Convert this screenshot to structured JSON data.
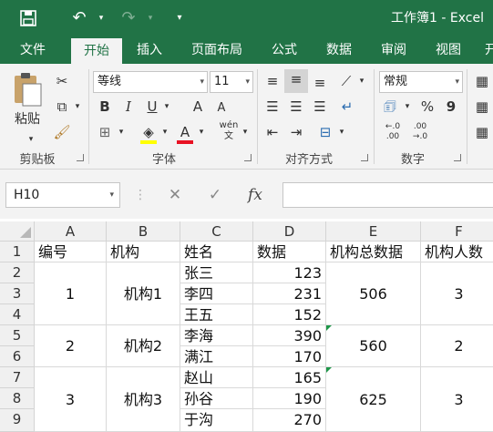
{
  "titlebar": {
    "save_icon": "floppy-disk-icon",
    "undo_icon": "undo-icon",
    "redo_icon": "redo-icon",
    "customize_icon": "chevron-down-icon",
    "title": "工作簿1 - Excel"
  },
  "tabs": [
    "文件",
    "开始",
    "插入",
    "页面布局",
    "公式",
    "数据",
    "审阅",
    "视图",
    "开"
  ],
  "active_tab": "开始",
  "ribbon": {
    "clipboard": {
      "paste_label": "粘贴",
      "group_label": "剪贴板"
    },
    "font": {
      "name": "等线",
      "size": "11",
      "bold": "B",
      "italic": "I",
      "underline": "U",
      "grow": "A",
      "shrink": "A",
      "pinyin": "wén",
      "group_label": "字体"
    },
    "alignment": {
      "group_label": "对齐方式"
    },
    "number": {
      "format": "常规",
      "percent": "%",
      "comma": "9",
      "group_label": "数字"
    }
  },
  "formula_bar": {
    "name_box": "H10",
    "fx_label": "fx",
    "value": ""
  },
  "columns": [
    "A",
    "B",
    "C",
    "D",
    "E",
    "F"
  ],
  "rows": [
    "1",
    "2",
    "3",
    "4",
    "5",
    "6",
    "7",
    "8",
    "9"
  ],
  "headers": {
    "A": "编号",
    "B": "机构",
    "C": "姓名",
    "D": "数据",
    "E": "机构总数据",
    "F": "机构人数"
  },
  "groups": [
    {
      "id": "1",
      "org": "机构1",
      "total": "506",
      "count": "3"
    },
    {
      "id": "2",
      "org": "机构2",
      "total": "560",
      "count": "2"
    },
    {
      "id": "3",
      "org": "机构3",
      "total": "625",
      "count": "3"
    }
  ],
  "names": [
    "张三",
    "李四",
    "王五",
    "李海",
    "满江",
    "赵山",
    "孙谷",
    "于沟"
  ],
  "values": [
    "123",
    "231",
    "152",
    "390",
    "170",
    "165",
    "190",
    "270"
  ],
  "colors": {
    "excel_green": "#217346",
    "ribbon_bg": "#f3f3f3",
    "font_color_red": "#e81123",
    "highlight_yellow": "#ffff00"
  }
}
